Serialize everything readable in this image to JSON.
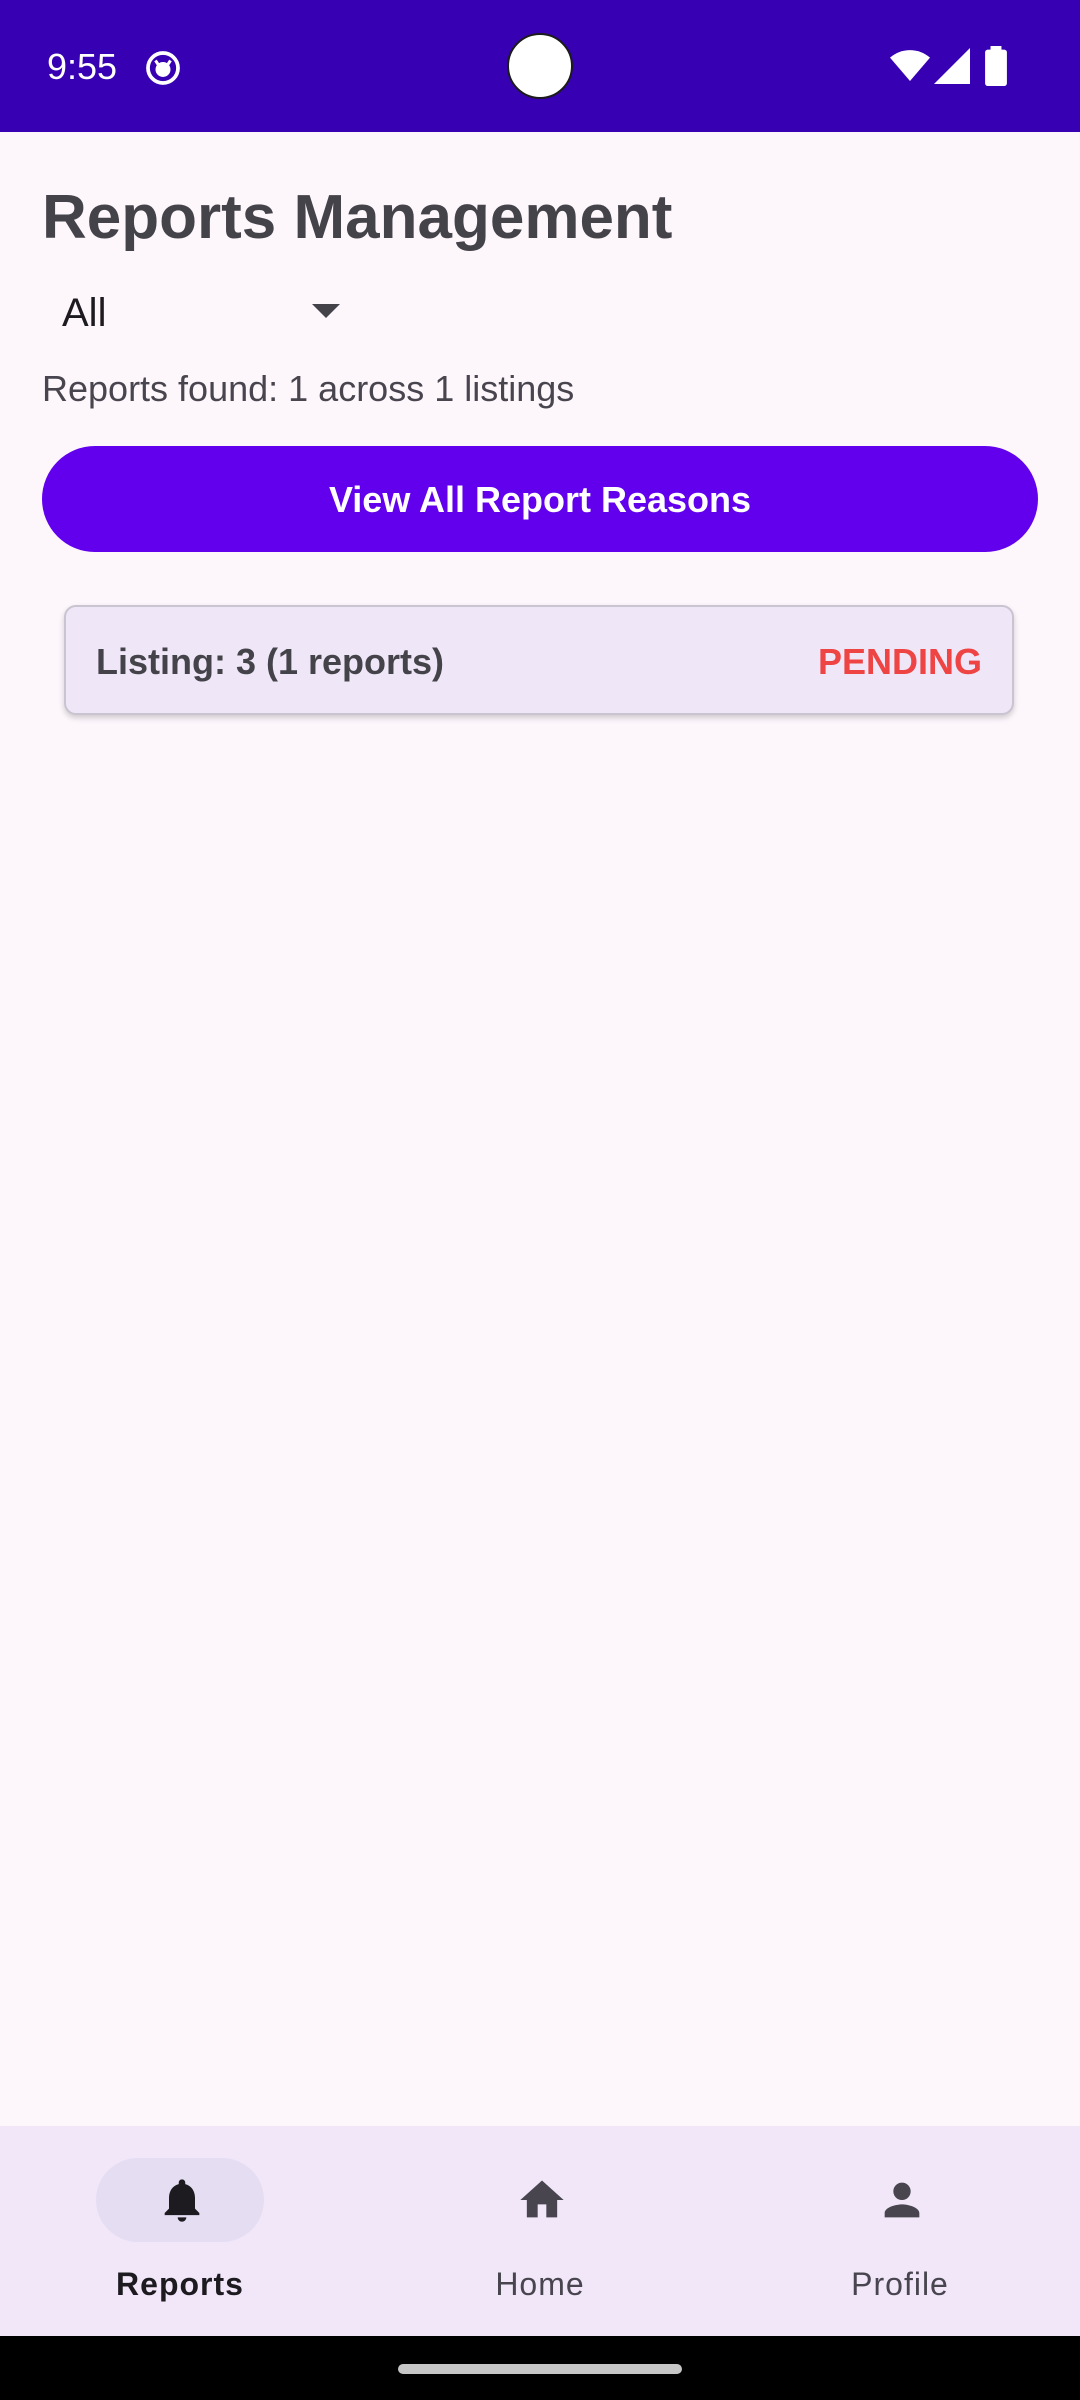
{
  "status_bar": {
    "time": "9:55",
    "background_color": "#3700b3",
    "icons": [
      "app-notification-icon",
      "wifi-icon",
      "signal-icon",
      "battery-icon"
    ]
  },
  "header": {
    "title": "Reports Management"
  },
  "filter": {
    "selected": "All"
  },
  "summary": {
    "reports_found_text": "Reports found: 1 across 1 listings"
  },
  "actions": {
    "view_reasons_label": "View All Report Reasons",
    "button_color": "#6200ee"
  },
  "listings": [
    {
      "title": "Listing: 3 (1 reports)",
      "status": "PENDING",
      "status_color": "#ef4444"
    }
  ],
  "bottom_nav": {
    "items": [
      {
        "label": "Reports",
        "icon": "bell-icon",
        "active": true
      },
      {
        "label": "Home",
        "icon": "home-icon",
        "active": false
      },
      {
        "label": "Profile",
        "icon": "person-icon",
        "active": false
      }
    ]
  }
}
